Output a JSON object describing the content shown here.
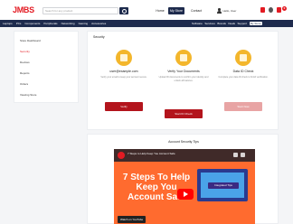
{
  "header": {
    "logo": "JMBS",
    "search_placeholder": "Search for any product",
    "links": {
      "home": "Home",
      "my_store": "My Store",
      "contact": "Contact"
    },
    "user_label": "Hello, User"
  },
  "cart": {
    "count": "0"
  },
  "nav": {
    "left": [
      "Laptops",
      "PCs",
      "Components",
      "Peripherals",
      "Networking",
      "Gaming",
      "Accessories"
    ],
    "right": [
      "Software",
      "Services",
      "Brands",
      "Deals",
      "Support",
      "My Store"
    ],
    "active_right": "My Store"
  },
  "sidebar": {
    "items": [
      {
        "label": "Store Dashboard"
      },
      {
        "label": "Security",
        "active": true
      },
      {
        "label": "Devices"
      },
      {
        "label": "Reports"
      },
      {
        "label": "Orders"
      },
      {
        "label": "Viewing Store"
      }
    ]
  },
  "security_section": {
    "title": "Security",
    "cards": [
      {
        "title": "user@example.com",
        "desc": "Verify your email to keep your account secure.",
        "button": "Verify",
        "button_style": "red"
      },
      {
        "title": "Verify Your Documents",
        "desc": "Upload ID documents to confirm your identity and unlock all features.",
        "button": "Start ID Check",
        "button_style": "red"
      },
      {
        "title": "Data ID Check",
        "desc": "Complete your data ID check to finish verification.",
        "button": "Start Now",
        "button_style": "pink"
      }
    ]
  },
  "account_security": {
    "title": "Account Security Tips",
    "video": {
      "channel_title": "7 Steps to Help Keep You Account Safe",
      "headline": "7 Steps To Help Keep You Account Safe",
      "tag": "Integrated Tips",
      "watch": "Watch on YouTube"
    }
  },
  "colors": {
    "brand_red": "#e31b23",
    "navy": "#1e2b4d",
    "accent_yellow": "#f3b62c",
    "video_orange": "#ff6b2f"
  },
  "icons": [
    "search-icon",
    "user-icon",
    "notification-icon",
    "cart-icon",
    "play-icon"
  ]
}
